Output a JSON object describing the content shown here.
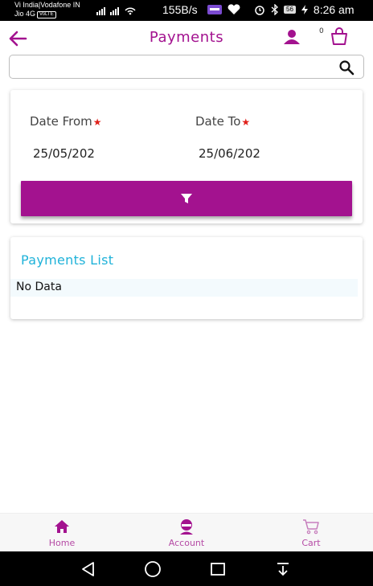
{
  "status_bar": {
    "carrier_line1": "Vi India|Vodafone IN",
    "carrier_line2": "Jio 4G",
    "volte_badge": "VoLTE",
    "network_speed": "155B/s",
    "battery": "56",
    "time": "8:26 am"
  },
  "app_bar": {
    "title": "Payments",
    "cart_count": "0",
    "icons": [
      "back-arrow-icon",
      "user-icon",
      "shopping-bag-icon"
    ]
  },
  "search": {
    "value": "",
    "placeholder": "",
    "icon": "search-icon"
  },
  "filter": {
    "date_from_label": "Date From",
    "date_to_label": "Date To",
    "required_mark": "★",
    "date_from_value": "25/05/202",
    "date_to_value": "25/06/202",
    "button_icon": "filter-icon"
  },
  "payments_list": {
    "title": "Payments List",
    "empty_text": "No Data"
  },
  "bottom_nav": {
    "items": [
      {
        "label": "Home",
        "icon": "home-icon"
      },
      {
        "label": "Account",
        "icon": "account-icon"
      },
      {
        "label": "Cart",
        "icon": "cart-icon"
      }
    ]
  },
  "colors": {
    "primary": "#a3128f",
    "accent_cyan": "#1fb2d9",
    "required_red": "#e0201a",
    "nav_label": "#b54aa5"
  }
}
